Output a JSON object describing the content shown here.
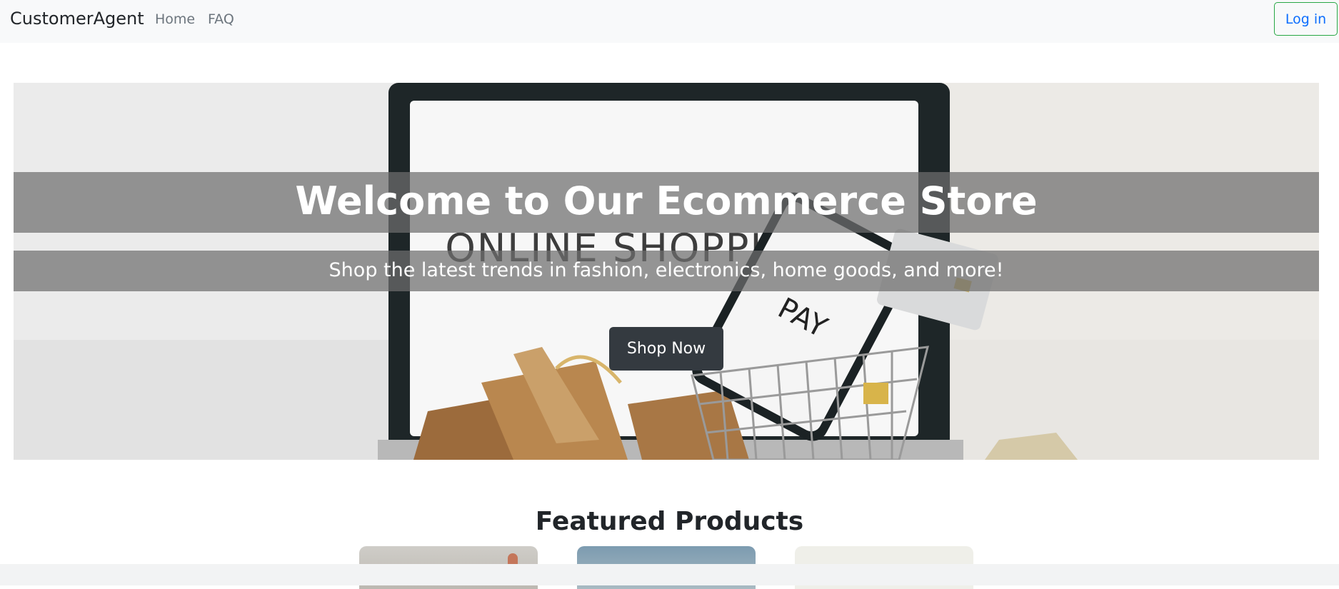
{
  "navbar": {
    "brand": "CustomerAgent",
    "links": [
      {
        "label": "Home"
      },
      {
        "label": "FAQ"
      }
    ],
    "login_label": "Log in"
  },
  "hero": {
    "title": "Welcome to Our Ecommerce Store",
    "subtitle": "Shop the latest trends in fashion, electronics, home goods, and more!",
    "cta_label": "Shop Now",
    "image_text_screen": "ONLINE SHOPPING",
    "image_text_phone": "PAY"
  },
  "featured": {
    "title": "Featured Products"
  },
  "colors": {
    "navbar_bg": "#f8f9fa",
    "login_border": "#28a745",
    "login_text": "#0d6efd",
    "cta_bg": "#343a40"
  }
}
